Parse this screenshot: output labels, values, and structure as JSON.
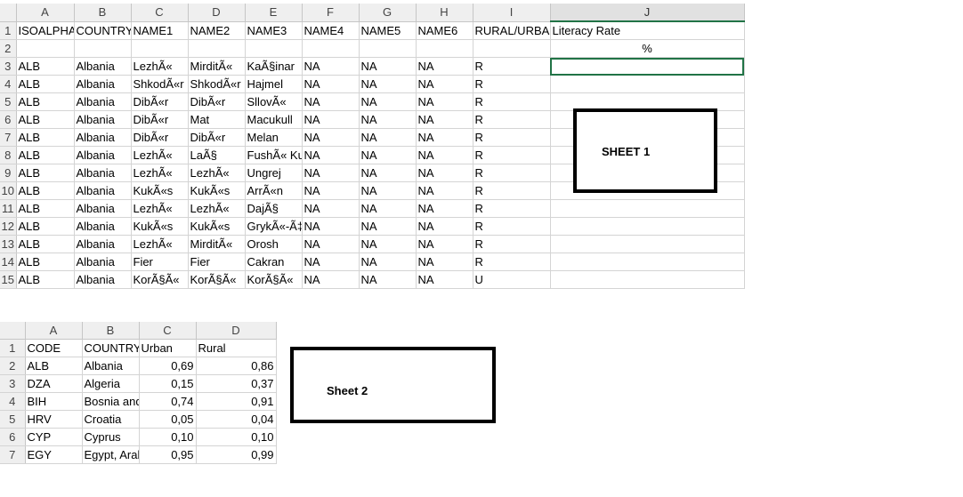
{
  "sheet1": {
    "columns": [
      "A",
      "B",
      "C",
      "D",
      "E",
      "F",
      "G",
      "H",
      "I",
      "J"
    ],
    "selected_column": "J",
    "rows": [
      {
        "n": "1",
        "cells": [
          "ISOALPHA",
          "COUNTRY",
          "NAME1",
          "NAME2",
          "NAME3",
          "NAME4",
          "NAME5",
          "NAME6",
          "RURAL/URBAN",
          "Literacy Rate"
        ]
      },
      {
        "n": "2",
        "cells": [
          "",
          "",
          "",
          "",
          "",
          "",
          "",
          "",
          "",
          "%"
        ]
      },
      {
        "n": "3",
        "cells": [
          "ALB",
          "Albania",
          "LezhÃ«",
          "MirditÃ«",
          "KaÃ§inar",
          "NA",
          "NA",
          "NA",
          "R",
          ""
        ]
      },
      {
        "n": "4",
        "cells": [
          "ALB",
          "Albania",
          "ShkodÃ«r",
          "ShkodÃ«r",
          "Hajmel",
          "NA",
          "NA",
          "NA",
          "R",
          ""
        ]
      },
      {
        "n": "5",
        "cells": [
          "ALB",
          "Albania",
          "DibÃ«r",
          "DibÃ«r",
          "SllovÃ«",
          "NA",
          "NA",
          "NA",
          "R",
          ""
        ]
      },
      {
        "n": "6",
        "cells": [
          "ALB",
          "Albania",
          "DibÃ«r",
          "Mat",
          "Macukull",
          "NA",
          "NA",
          "NA",
          "R",
          ""
        ]
      },
      {
        "n": "7",
        "cells": [
          "ALB",
          "Albania",
          "DibÃ«r",
          "DibÃ«r",
          "Melan",
          "NA",
          "NA",
          "NA",
          "R",
          ""
        ]
      },
      {
        "n": "8",
        "cells": [
          "ALB",
          "Albania",
          "LezhÃ«",
          "LaÃ§",
          "FushÃ« Kuqe",
          "NA",
          "NA",
          "NA",
          "R",
          ""
        ]
      },
      {
        "n": "9",
        "cells": [
          "ALB",
          "Albania",
          "LezhÃ«",
          "LezhÃ«",
          "Ungrej",
          "NA",
          "NA",
          "NA",
          "R",
          ""
        ]
      },
      {
        "n": "10",
        "cells": [
          "ALB",
          "Albania",
          "KukÃ«s",
          "KukÃ«s",
          "ArrÃ«n",
          "NA",
          "NA",
          "NA",
          "R",
          ""
        ]
      },
      {
        "n": "11",
        "cells": [
          "ALB",
          "Albania",
          "LezhÃ«",
          "LezhÃ«",
          "DajÃ§",
          "NA",
          "NA",
          "NA",
          "R",
          ""
        ]
      },
      {
        "n": "12",
        "cells": [
          "ALB",
          "Albania",
          "KukÃ«s",
          "KukÃ«s",
          "GrykÃ«-Ã‡ajÃ«",
          "NA",
          "NA",
          "NA",
          "R",
          ""
        ]
      },
      {
        "n": "13",
        "cells": [
          "ALB",
          "Albania",
          "LezhÃ«",
          "MirditÃ«",
          "Orosh",
          "NA",
          "NA",
          "NA",
          "R",
          ""
        ]
      },
      {
        "n": "14",
        "cells": [
          "ALB",
          "Albania",
          "Fier",
          "Fier",
          "Cakran",
          "NA",
          "NA",
          "NA",
          "R",
          ""
        ]
      },
      {
        "n": "15",
        "cells": [
          "ALB",
          "Albania",
          "KorÃ§Ã«",
          "KorÃ§Ã«",
          "KorÃ§Ã«",
          "NA",
          "NA",
          "NA",
          "U",
          ""
        ]
      }
    ]
  },
  "sheet2": {
    "columns": [
      "A",
      "B",
      "C",
      "D"
    ],
    "rows": [
      {
        "n": "1",
        "cells": [
          "CODE",
          "COUNTRY",
          "Urban",
          "Rural"
        ]
      },
      {
        "n": "2",
        "cells": [
          "ALB",
          "Albania",
          "0,69",
          "0,86"
        ]
      },
      {
        "n": "3",
        "cells": [
          "DZA",
          "Algeria",
          "0,15",
          "0,37"
        ]
      },
      {
        "n": "4",
        "cells": [
          "BIH",
          "Bosnia and Herzegovina",
          "0,74",
          "0,91"
        ]
      },
      {
        "n": "5",
        "cells": [
          "HRV",
          "Croatia",
          "0,05",
          "0,04"
        ]
      },
      {
        "n": "6",
        "cells": [
          "CYP",
          "Cyprus",
          "0,10",
          "0,10"
        ]
      },
      {
        "n": "7",
        "cells": [
          "EGY",
          "Egypt, Arab Rep.",
          "0,95",
          "0,99"
        ]
      }
    ]
  },
  "labels": {
    "box1": "SHEET 1",
    "box2": "Sheet 2"
  }
}
